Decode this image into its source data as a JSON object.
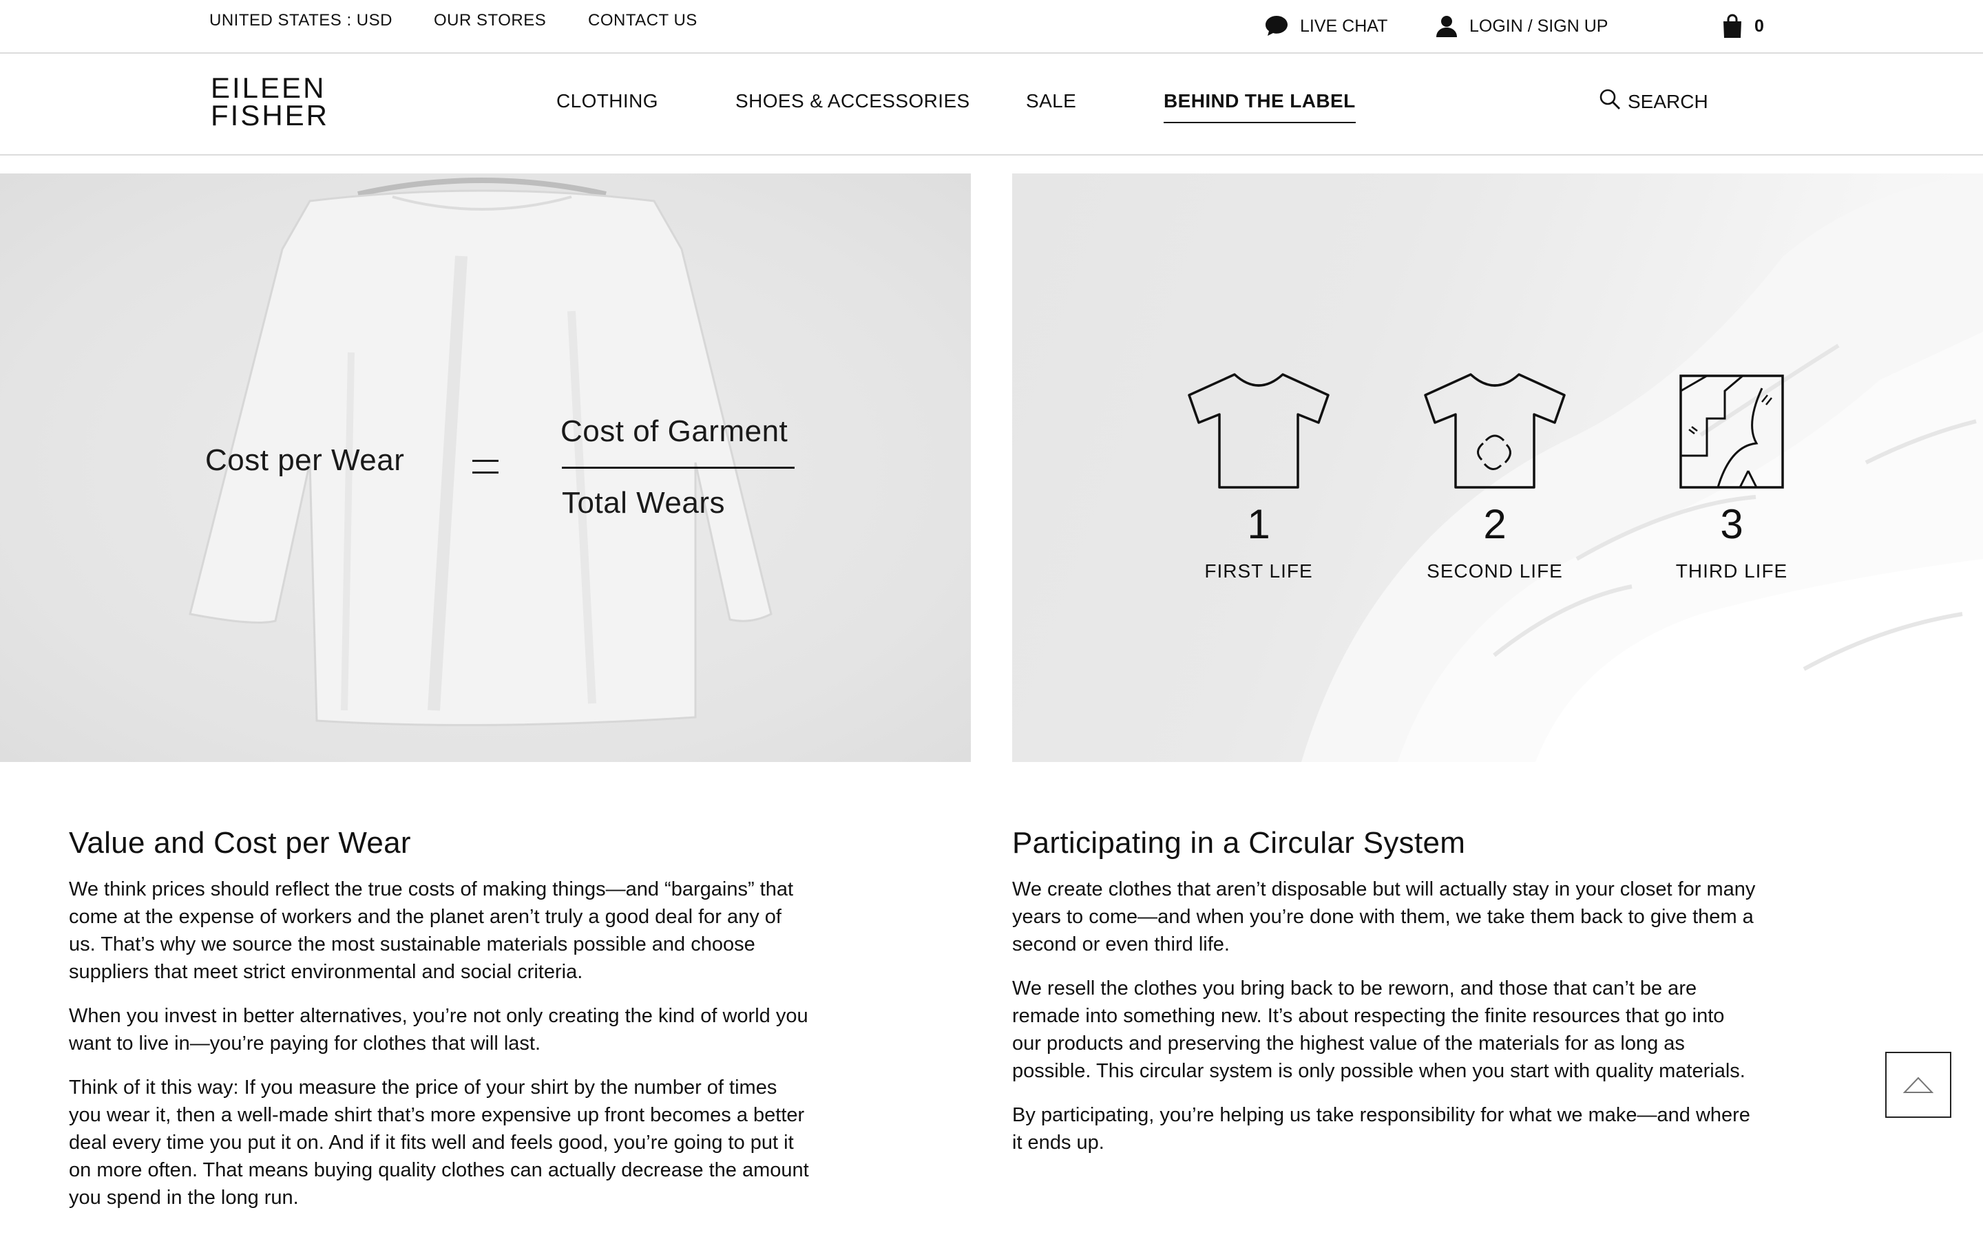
{
  "utility": {
    "region": "UNITED STATES : USD",
    "stores": "OUR STORES",
    "contact": "CONTACT US",
    "live_chat": "LIVE CHAT",
    "login": "LOGIN / SIGN UP",
    "cart_count": "0"
  },
  "brand": {
    "line1": "EILEEN",
    "line2": "FISHER"
  },
  "nav": {
    "items": [
      {
        "label": "CLOTHING"
      },
      {
        "label": "SHOES & ACCESSORIES"
      },
      {
        "label": "SALE"
      },
      {
        "label": "BEHIND THE LABEL",
        "active": true
      }
    ],
    "search_label": "SEARCH"
  },
  "hero_left": {
    "formula_left": "Cost per Wear",
    "numerator": "Cost of Garment",
    "denominator": "Total Wears"
  },
  "hero_right": {
    "lives": [
      {
        "number": "1",
        "label": "FIRST LIFE"
      },
      {
        "number": "2",
        "label": "SECOND LIFE"
      },
      {
        "number": "3",
        "label": "THIRD LIFE"
      }
    ]
  },
  "value_section": {
    "title": "Value and Cost per Wear",
    "paragraphs": [
      "We think prices should reflect the true costs of making things—and “bargains” that come at the expense of workers and the planet aren’t truly a good deal for any of us. That’s why we source the most sustainable materials possible and choose suppliers that meet strict environmental and social criteria.",
      "When you invest in better alternatives, you’re not only creating the kind of world you want to live in—you’re paying for clothes that will last.",
      "Think of it this way: If you measure the price of your shirt by the number of times you wear it, then a well-made shirt that’s more expensive up front becomes a better deal every time you put it on. And if it fits well and feels good, you’re going to put it on more often. That means buying quality clothes can actually decrease the amount you spend in the long run."
    ]
  },
  "circular_section": {
    "title": "Participating in a Circular System",
    "paragraphs": [
      "We create clothes that aren’t disposable but will actually stay in your closet for many years to come—and when you’re done with them, we take them back to give them a second or even third life.",
      "We resell the clothes you bring back to be reworn, and those that can’t be are remade into something new. It’s about respecting the finite resources that go into our products and preserving the highest value of the materials for as long as possible. This circular system is only possible when you start with quality materials.",
      "By participating, you’re helping us take responsibility for what we make—and where it ends up."
    ]
  },
  "icons": {
    "chat": "chat-bubble-icon",
    "user": "user-icon",
    "cart": "shopping-bag-icon",
    "search": "search-icon",
    "back_to_top": "triangle-up-icon"
  }
}
